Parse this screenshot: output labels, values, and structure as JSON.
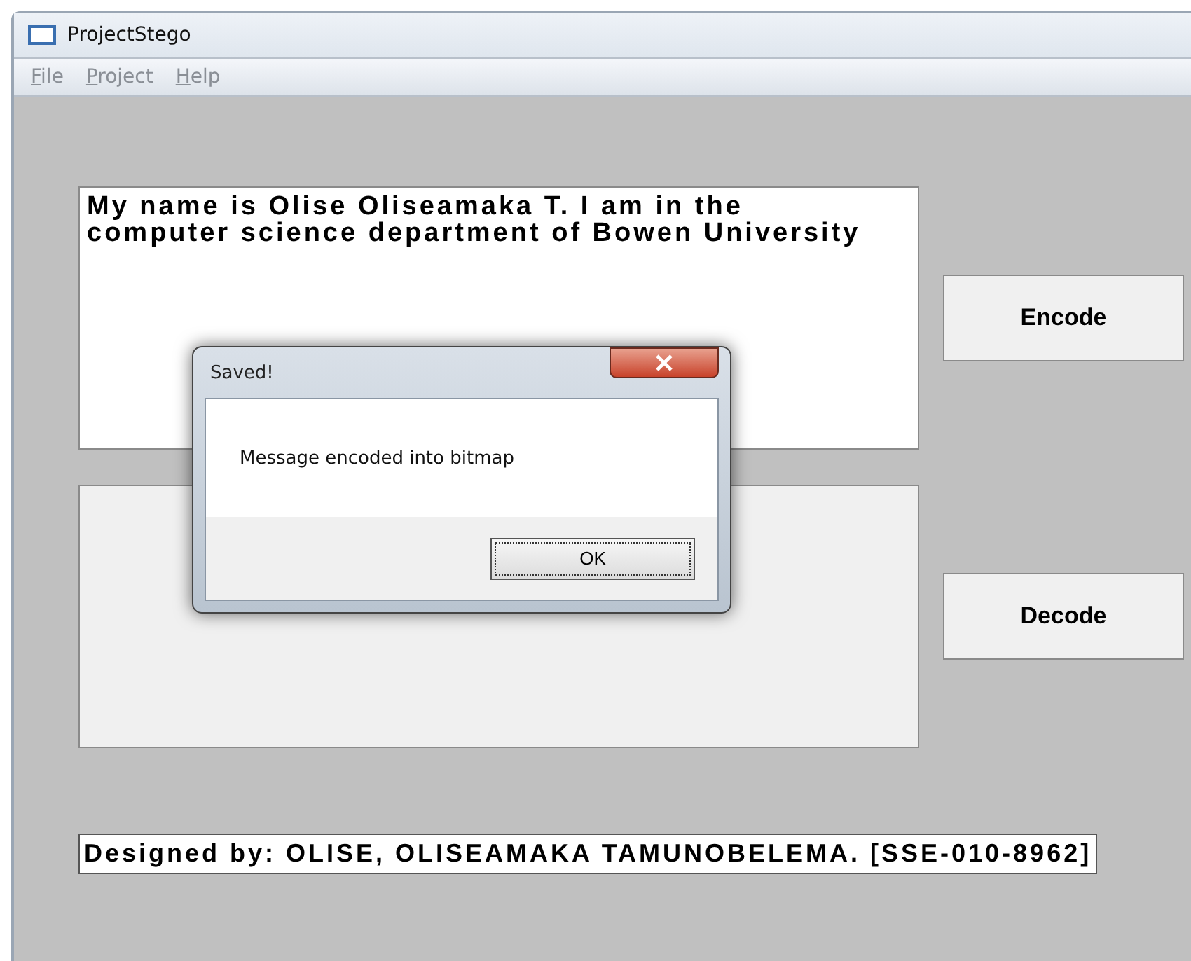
{
  "window": {
    "title": "ProjectStego"
  },
  "menu": [
    "File",
    "Project",
    "Help"
  ],
  "message_box": {
    "value": "My name is Olise Oliseamaka T. I am in the computer science department of Bowen University"
  },
  "buttons": [
    "Encode",
    "Decode"
  ],
  "credit": "Designed by: OLISE, OLISEAMAKA TAMUNOBELEMA. [SSE-010-8962]",
  "dialog": {
    "title": "Saved!",
    "message": "Message encoded into bitmap",
    "button": "OK"
  }
}
